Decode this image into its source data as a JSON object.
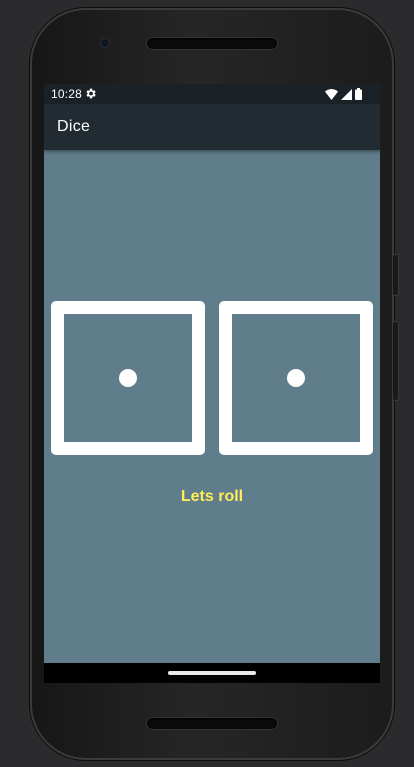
{
  "status_bar": {
    "time": "10:28",
    "icons": [
      "gear-icon",
      "wifi-icon",
      "signal-icon",
      "battery-icon"
    ]
  },
  "app_bar": {
    "title": "Dice"
  },
  "dice": {
    "left_face": 1,
    "right_face": 1
  },
  "roll_label": "Lets roll",
  "colors": {
    "content_background": "#607d8b",
    "app_bar": "#212b31",
    "status_bar": "#1a2227",
    "label_text": "#ffee58",
    "dice": "#ffffff"
  }
}
